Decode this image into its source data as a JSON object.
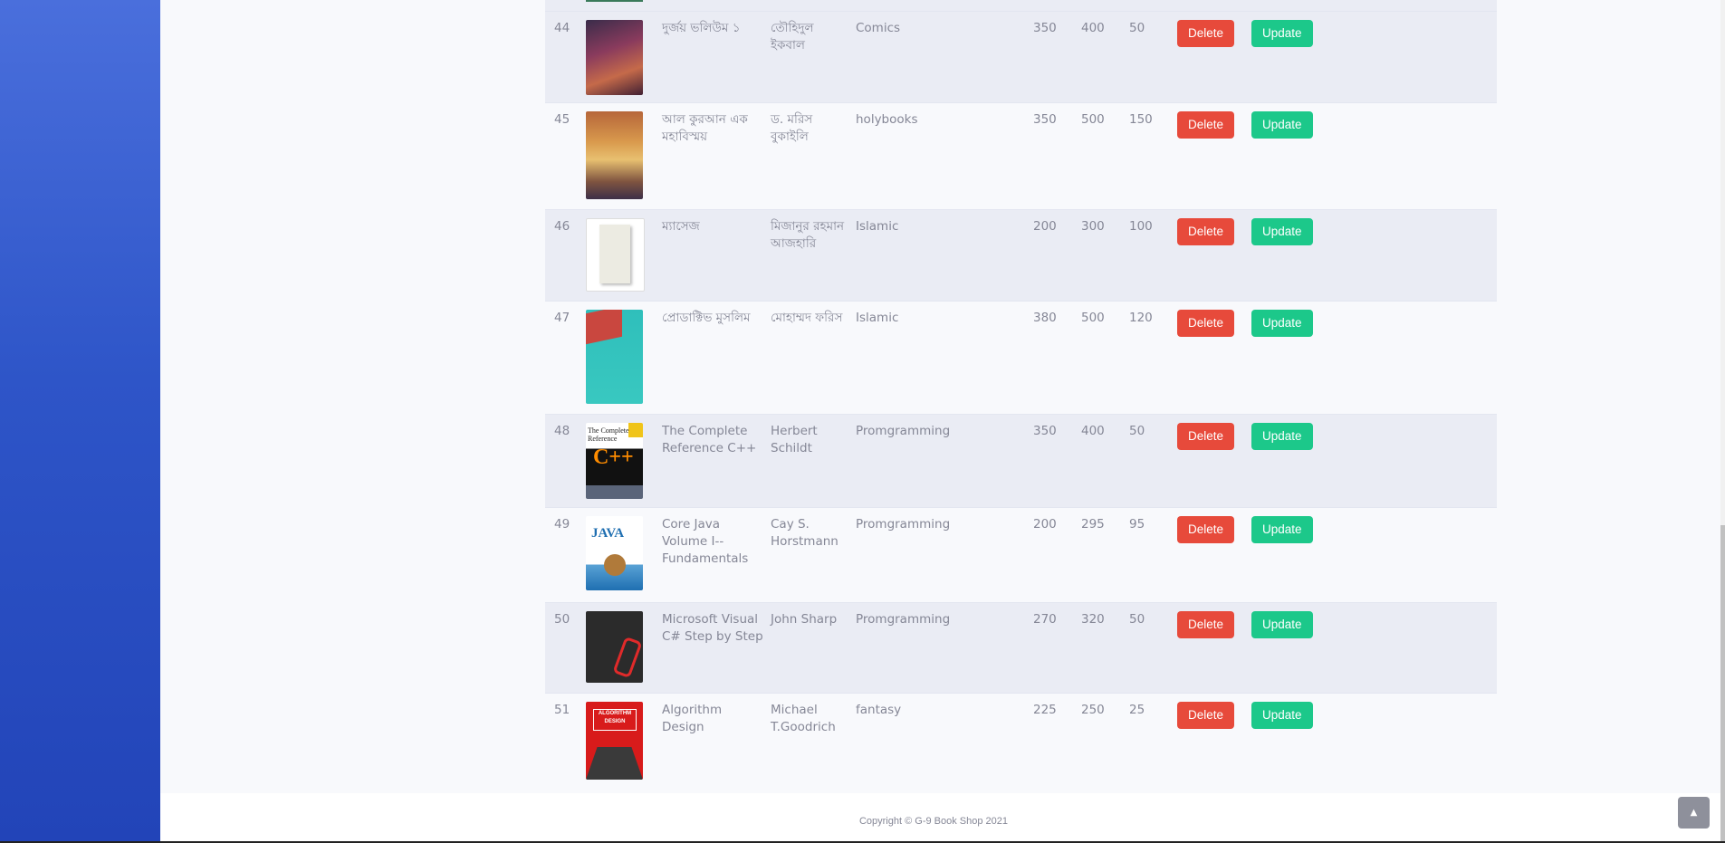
{
  "books": [
    {
      "id": "44",
      "name": "দুর্জয় ভলিউম ১",
      "author": "তৌহিদুল ইকবাল",
      "category": "Comics",
      "cost": "350",
      "price": "400",
      "stock": "50",
      "cover": "comic-cover"
    },
    {
      "id": "45",
      "name": "আল কুরআন এক মহাবিস্ময়",
      "author": "ড. মরিস বুকাইলি",
      "category": "holybooks",
      "cost": "350",
      "price": "500",
      "stock": "150",
      "cover": "quran-cover"
    },
    {
      "id": "46",
      "name": "ম্যাসেজ",
      "author": "মিজানুর রহমান আজহারি",
      "category": "Islamic",
      "cost": "200",
      "price": "300",
      "stock": "100",
      "cover": "message-cover"
    },
    {
      "id": "47",
      "name": "প্রোডাক্টিভ মুসলিম",
      "author": "মোহাম্মদ ফরিস",
      "category": "Islamic",
      "cost": "380",
      "price": "500",
      "stock": "120",
      "cover": "productive-muslim-cover"
    },
    {
      "id": "48",
      "name": "The Complete Reference C++",
      "author": "Herbert Schildt",
      "category": "Promgramming",
      "cost": "350",
      "price": "400",
      "stock": "50",
      "cover": "cpp-cover"
    },
    {
      "id": "49",
      "name": "Core Java Volume I--Fundamentals",
      "author": "Cay S. Horstmann",
      "category": "Promgramming",
      "cost": "200",
      "price": "295",
      "stock": "95",
      "cover": "java-cover"
    },
    {
      "id": "50",
      "name": "Microsoft Visual C# Step by Step",
      "author": "John Sharp",
      "category": "Promgramming",
      "cost": "270",
      "price": "320",
      "stock": "50",
      "cover": "csharp-cover"
    },
    {
      "id": "51",
      "name": "Algorithm Design",
      "author": "Michael T.Goodrich",
      "category": "fantasy",
      "cost": "225",
      "price": "250",
      "stock": "25",
      "cover": "algorithm-cover"
    }
  ],
  "actions": {
    "delete_label": "Delete",
    "update_label": "Update"
  },
  "cover_text": {
    "cpp_ref": "The Complete Reference",
    "cpp_title": "C++",
    "java_title": "JAVA",
    "algorithm_title": "ALGORITHM DESIGN"
  },
  "footer": {
    "copyright": "Copyright © G-9 Book Shop 2021"
  },
  "scroll_top_icon": "chevron-up-icon",
  "colors": {
    "sidebar": "#2e55c8",
    "delete": "#e74a3b",
    "update": "#1cc88a",
    "row_stripe": "#eaecf4"
  }
}
